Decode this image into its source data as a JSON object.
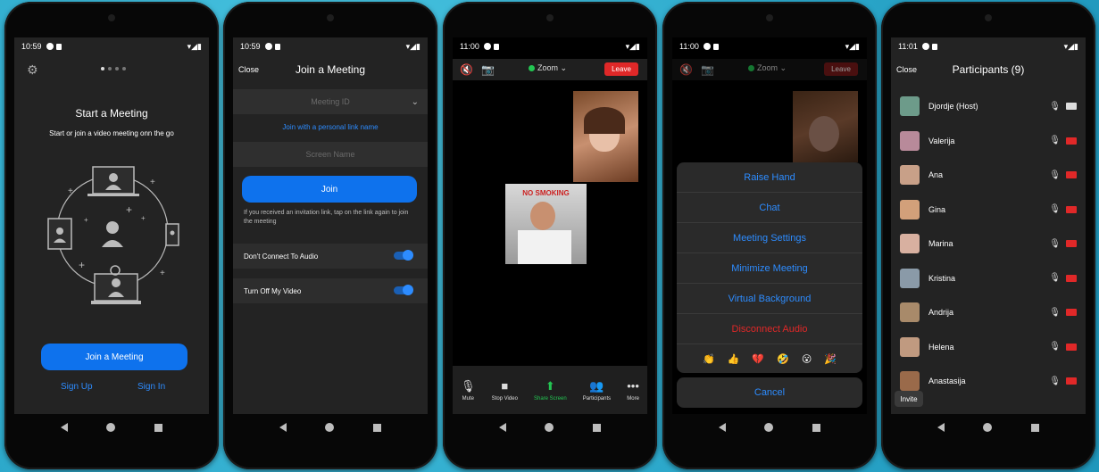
{
  "screens": {
    "s1": {
      "time": "10:59",
      "title": "Start a Meeting",
      "subtitle": "Start or join a video meeting onn the go",
      "join_button": "Join a Meeting",
      "sign_up": "Sign Up",
      "sign_in": "Sign In",
      "icon_settings": "gear-icon"
    },
    "s2": {
      "time": "10:59",
      "close": "Close",
      "title": "Join a Meeting",
      "meeting_id_placeholder": "Meeting ID",
      "personal_link": "Join with a personal link name",
      "screen_name_placeholder": "Screen Name",
      "join_button": "Join",
      "invitation_note": "If you received an invitation link, tap on the link again to join the meeting",
      "audio_toggle_label": "Don't Connect To Audio",
      "video_toggle_label": "Turn Off My Video",
      "audio_toggle_on": true,
      "video_toggle_on": true
    },
    "s3": {
      "time": "11:00",
      "app_name": "Zoom",
      "leave": "Leave",
      "video_sign_text": "NO SMOKING",
      "toolbar": [
        {
          "label": "Mute",
          "icon": "mic-icon"
        },
        {
          "label": "Stop Video",
          "icon": "camera-icon"
        },
        {
          "label": "Share Screen",
          "icon": "share-icon"
        },
        {
          "label": "Participants",
          "icon": "participants-icon"
        },
        {
          "label": "More",
          "icon": "more-icon"
        }
      ]
    },
    "s4": {
      "time": "11:00",
      "app_name": "Zoom",
      "leave": "Leave",
      "menu": [
        "Raise Hand",
        "Chat",
        "Meeting Settings",
        "Minimize Meeting",
        "Virtual Background",
        "Disconnect Audio"
      ],
      "emojis": [
        "👏",
        "👍",
        "💔",
        "🤣",
        "😮",
        "🎉"
      ],
      "cancel": "Cancel"
    },
    "s5": {
      "time": "11:01",
      "close": "Close",
      "title": "Participants (9)",
      "invite": "Invite",
      "participants": [
        {
          "name": "Djordje (Host)",
          "video_on": true
        },
        {
          "name": "Valerija",
          "video_on": false
        },
        {
          "name": "Ana",
          "video_on": false
        },
        {
          "name": "Gina",
          "video_on": false
        },
        {
          "name": "Marina",
          "video_on": false
        },
        {
          "name": "Kristina",
          "video_on": false
        },
        {
          "name": "Andrija",
          "video_on": false
        },
        {
          "name": "Helena",
          "video_on": false
        },
        {
          "name": "Anastasija",
          "video_on": false
        }
      ]
    }
  },
  "colors": {
    "zoom_blue": "#0e72ed",
    "link_blue": "#2d8cff",
    "leave_red": "#e02828",
    "share_green": "#23c552",
    "background": "#38b6d6"
  }
}
